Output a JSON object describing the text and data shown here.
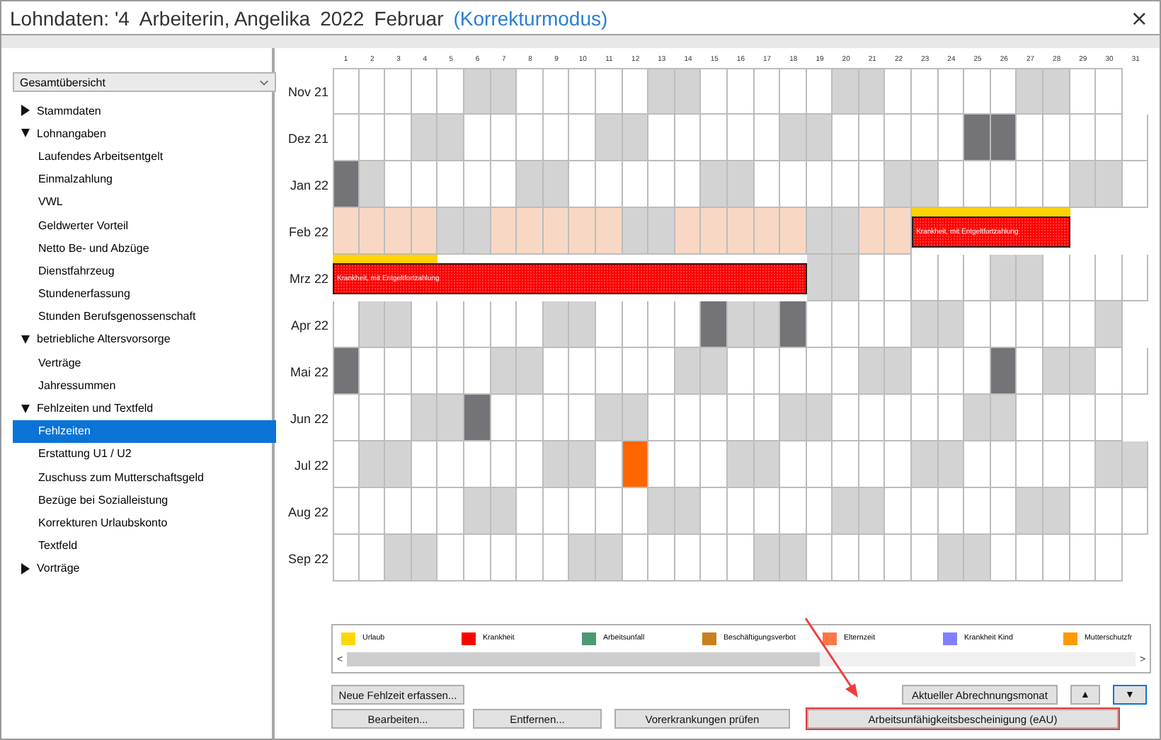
{
  "window": {
    "title_parts": [
      "Lohndaten: '4",
      "Arbeiterin, Angelika",
      "2022",
      "Februar"
    ],
    "mode": "(Korrekturmodus)",
    "close_glyph": "×"
  },
  "sidebar": {
    "dropdown": {
      "value": "Gesamtübersicht"
    },
    "tree": [
      {
        "label": "Stammdaten",
        "expanded": false
      },
      {
        "label": "Lohnangaben",
        "expanded": true,
        "children": [
          {
            "label": "Laufendes Arbeitsentgelt",
            "selected": false
          },
          {
            "label": "Einmalzahlung",
            "selected": false
          },
          {
            "label": "VWL",
            "selected": false
          },
          {
            "label": "Geldwerter Vorteil",
            "selected": false
          },
          {
            "label": "Netto Be- und Abzüge",
            "selected": false
          },
          {
            "label": "Dienstfahrzeug",
            "selected": false
          },
          {
            "label": "Stundenerfassung",
            "selected": false
          },
          {
            "label": "Stunden Berufsgenossenschaft",
            "selected": false
          }
        ]
      },
      {
        "label": "betriebliche Altersvorsorge",
        "expanded": true,
        "children": [
          {
            "label": "Verträge",
            "selected": false
          },
          {
            "label": "Jahressummen",
            "selected": false
          }
        ]
      },
      {
        "label": "Fehlzeiten und Textfeld",
        "expanded": true,
        "children": [
          {
            "label": "Fehlzeiten",
            "selected": true
          },
          {
            "label": "Erstattung U1 / U2",
            "selected": false
          },
          {
            "label": "Zuschuss zum Mutterschaftsgeld",
            "selected": false
          },
          {
            "label": "Bezüge bei Sozialleistung",
            "selected": false
          },
          {
            "label": "Korrekturen Urlaubskonto",
            "selected": false
          },
          {
            "label": "Textfeld",
            "selected": false
          }
        ]
      },
      {
        "label": "Vorträge",
        "expanded": false
      }
    ]
  },
  "calendar": {
    "day_numbers": [
      "1",
      "2",
      "3",
      "4",
      "5",
      "6",
      "7",
      "8",
      "9",
      "10",
      "11",
      "12",
      "13",
      "14",
      "15",
      "16",
      "17",
      "18",
      "19",
      "20",
      "21",
      "22",
      "23",
      "24",
      "25",
      "26",
      "27",
      "28",
      "29",
      "30",
      "31"
    ],
    "months": [
      {
        "label": "Nov 21",
        "days": [
          {
            "kind": "work"
          },
          {
            "kind": "work"
          },
          {
            "kind": "work"
          },
          {
            "kind": "work"
          },
          {
            "kind": "work"
          },
          {
            "kind": "off"
          },
          {
            "kind": "off"
          },
          {
            "kind": "work"
          },
          {
            "kind": "work"
          },
          {
            "kind": "work"
          },
          {
            "kind": "work"
          },
          {
            "kind": "work"
          },
          {
            "kind": "off"
          },
          {
            "kind": "off"
          },
          {
            "kind": "work"
          },
          {
            "kind": "work"
          },
          {
            "kind": "work"
          },
          {
            "kind": "work"
          },
          {
            "kind": "work"
          },
          {
            "kind": "off"
          },
          {
            "kind": "off"
          },
          {
            "kind": "work"
          },
          {
            "kind": "work"
          },
          {
            "kind": "work"
          },
          {
            "kind": "work"
          },
          {
            "kind": "work"
          },
          {
            "kind": "off"
          },
          {
            "kind": "off"
          },
          {
            "kind": "work"
          },
          {
            "kind": "work"
          }
        ]
      },
      {
        "label": "Dez 21",
        "days": [
          {
            "kind": "work"
          },
          {
            "kind": "work"
          },
          {
            "kind": "work"
          },
          {
            "kind": "off"
          },
          {
            "kind": "off"
          },
          {
            "kind": "work"
          },
          {
            "kind": "work"
          },
          {
            "kind": "work"
          },
          {
            "kind": "work"
          },
          {
            "kind": "work"
          },
          {
            "kind": "off"
          },
          {
            "kind": "off"
          },
          {
            "kind": "work"
          },
          {
            "kind": "work"
          },
          {
            "kind": "work"
          },
          {
            "kind": "work"
          },
          {
            "kind": "work"
          },
          {
            "kind": "off"
          },
          {
            "kind": "off"
          },
          {
            "kind": "work"
          },
          {
            "kind": "work"
          },
          {
            "kind": "work"
          },
          {
            "kind": "work"
          },
          {
            "kind": "work"
          },
          {
            "kind": "holiday"
          },
          {
            "kind": "holiday"
          },
          {
            "kind": "work"
          },
          {
            "kind": "work"
          },
          {
            "kind": "work"
          },
          {
            "kind": "work"
          },
          {
            "kind": "work"
          }
        ]
      },
      {
        "label": "Jan 22",
        "days": [
          {
            "kind": "holiday"
          },
          {
            "kind": "off"
          },
          {
            "kind": "work"
          },
          {
            "kind": "work"
          },
          {
            "kind": "work"
          },
          {
            "kind": "work"
          },
          {
            "kind": "work"
          },
          {
            "kind": "off"
          },
          {
            "kind": "off"
          },
          {
            "kind": "work"
          },
          {
            "kind": "work"
          },
          {
            "kind": "work"
          },
          {
            "kind": "work"
          },
          {
            "kind": "work"
          },
          {
            "kind": "off"
          },
          {
            "kind": "off"
          },
          {
            "kind": "work"
          },
          {
            "kind": "work"
          },
          {
            "kind": "work"
          },
          {
            "kind": "work"
          },
          {
            "kind": "work"
          },
          {
            "kind": "off"
          },
          {
            "kind": "off"
          },
          {
            "kind": "work"
          },
          {
            "kind": "work"
          },
          {
            "kind": "work"
          },
          {
            "kind": "work"
          },
          {
            "kind": "work"
          },
          {
            "kind": "off"
          },
          {
            "kind": "off"
          },
          {
            "kind": "work"
          }
        ]
      },
      {
        "label": "Feb 22",
        "absence_label": "Krankheit, mit Entgeltfortzahlung",
        "days": [
          {
            "kind": "month"
          },
          {
            "kind": "month"
          },
          {
            "kind": "month"
          },
          {
            "kind": "month"
          },
          {
            "kind": "off"
          },
          {
            "kind": "off"
          },
          {
            "kind": "month"
          },
          {
            "kind": "month"
          },
          {
            "kind": "month"
          },
          {
            "kind": "month"
          },
          {
            "kind": "month"
          },
          {
            "kind": "off"
          },
          {
            "kind": "off"
          },
          {
            "kind": "month"
          },
          {
            "kind": "month"
          },
          {
            "kind": "month"
          },
          {
            "kind": "month"
          },
          {
            "kind": "month"
          },
          {
            "kind": "off"
          },
          {
            "kind": "off"
          },
          {
            "kind": "month"
          },
          {
            "kind": "month"
          },
          {
            "kind": "sickvac"
          },
          {
            "kind": "sickvac"
          },
          {
            "kind": "sickvac"
          },
          {
            "kind": "sickvac"
          },
          {
            "kind": "sickvac"
          },
          {
            "kind": "sickvac"
          }
        ]
      },
      {
        "label": "Mrz 22",
        "absence_label": "Krankheit, mit Entgeltfortzahlung",
        "days": [
          {
            "kind": "sickvac"
          },
          {
            "kind": "sickvac"
          },
          {
            "kind": "sickvac"
          },
          {
            "kind": "sickvac"
          },
          {
            "kind": "sick"
          },
          {
            "kind": "sick"
          },
          {
            "kind": "sick"
          },
          {
            "kind": "sick"
          },
          {
            "kind": "sick"
          },
          {
            "kind": "sick"
          },
          {
            "kind": "sick"
          },
          {
            "kind": "sick"
          },
          {
            "kind": "sick"
          },
          {
            "kind": "sick"
          },
          {
            "kind": "sick"
          },
          {
            "kind": "sick"
          },
          {
            "kind": "sick"
          },
          {
            "kind": "sick"
          },
          {
            "kind": "off"
          },
          {
            "kind": "off"
          },
          {
            "kind": "work"
          },
          {
            "kind": "work"
          },
          {
            "kind": "work"
          },
          {
            "kind": "work"
          },
          {
            "kind": "work"
          },
          {
            "kind": "off"
          },
          {
            "kind": "off"
          },
          {
            "kind": "work"
          },
          {
            "kind": "work"
          },
          {
            "kind": "work"
          },
          {
            "kind": "work"
          }
        ]
      },
      {
        "label": "Apr 22",
        "days": [
          {
            "kind": "work"
          },
          {
            "kind": "off"
          },
          {
            "kind": "off"
          },
          {
            "kind": "work"
          },
          {
            "kind": "work"
          },
          {
            "kind": "work"
          },
          {
            "kind": "work"
          },
          {
            "kind": "work"
          },
          {
            "kind": "off"
          },
          {
            "kind": "off"
          },
          {
            "kind": "work"
          },
          {
            "kind": "work"
          },
          {
            "kind": "work"
          },
          {
            "kind": "work"
          },
          {
            "kind": "holiday"
          },
          {
            "kind": "off"
          },
          {
            "kind": "off"
          },
          {
            "kind": "holiday"
          },
          {
            "kind": "work"
          },
          {
            "kind": "work"
          },
          {
            "kind": "work"
          },
          {
            "kind": "work"
          },
          {
            "kind": "off"
          },
          {
            "kind": "off"
          },
          {
            "kind": "work"
          },
          {
            "kind": "work"
          },
          {
            "kind": "work"
          },
          {
            "kind": "work"
          },
          {
            "kind": "work"
          },
          {
            "kind": "off"
          }
        ]
      },
      {
        "label": "Mai 22",
        "days": [
          {
            "kind": "holiday"
          },
          {
            "kind": "work"
          },
          {
            "kind": "work"
          },
          {
            "kind": "work"
          },
          {
            "kind": "work"
          },
          {
            "kind": "work"
          },
          {
            "kind": "off"
          },
          {
            "kind": "off"
          },
          {
            "kind": "work"
          },
          {
            "kind": "work"
          },
          {
            "kind": "work"
          },
          {
            "kind": "work"
          },
          {
            "kind": "work"
          },
          {
            "kind": "off"
          },
          {
            "kind": "off"
          },
          {
            "kind": "work"
          },
          {
            "kind": "work"
          },
          {
            "kind": "work"
          },
          {
            "kind": "work"
          },
          {
            "kind": "work"
          },
          {
            "kind": "off"
          },
          {
            "kind": "off"
          },
          {
            "kind": "work"
          },
          {
            "kind": "work"
          },
          {
            "kind": "work"
          },
          {
            "kind": "holiday"
          },
          {
            "kind": "work"
          },
          {
            "kind": "off"
          },
          {
            "kind": "off"
          },
          {
            "kind": "work"
          },
          {
            "kind": "work"
          }
        ]
      },
      {
        "label": "Jun 22",
        "days": [
          {
            "kind": "work"
          },
          {
            "kind": "work"
          },
          {
            "kind": "work"
          },
          {
            "kind": "off"
          },
          {
            "kind": "off"
          },
          {
            "kind": "holiday"
          },
          {
            "kind": "work"
          },
          {
            "kind": "work"
          },
          {
            "kind": "work"
          },
          {
            "kind": "work"
          },
          {
            "kind": "off"
          },
          {
            "kind": "off"
          },
          {
            "kind": "work"
          },
          {
            "kind": "work"
          },
          {
            "kind": "work"
          },
          {
            "kind": "work"
          },
          {
            "kind": "work"
          },
          {
            "kind": "off"
          },
          {
            "kind": "off"
          },
          {
            "kind": "work"
          },
          {
            "kind": "work"
          },
          {
            "kind": "work"
          },
          {
            "kind": "work"
          },
          {
            "kind": "work"
          },
          {
            "kind": "off"
          },
          {
            "kind": "off"
          },
          {
            "kind": "work"
          },
          {
            "kind": "work"
          },
          {
            "kind": "work"
          },
          {
            "kind": "work"
          }
        ]
      },
      {
        "label": "Jul 22",
        "days": [
          {
            "kind": "work"
          },
          {
            "kind": "off"
          },
          {
            "kind": "off"
          },
          {
            "kind": "work"
          },
          {
            "kind": "work"
          },
          {
            "kind": "work"
          },
          {
            "kind": "work"
          },
          {
            "kind": "work"
          },
          {
            "kind": "off"
          },
          {
            "kind": "off"
          },
          {
            "kind": "work"
          },
          {
            "kind": "absence"
          },
          {
            "kind": "work"
          },
          {
            "kind": "work"
          },
          {
            "kind": "work"
          },
          {
            "kind": "off"
          },
          {
            "kind": "off"
          },
          {
            "kind": "work"
          },
          {
            "kind": "work"
          },
          {
            "kind": "work"
          },
          {
            "kind": "work"
          },
          {
            "kind": "work"
          },
          {
            "kind": "off"
          },
          {
            "kind": "off"
          },
          {
            "kind": "work"
          },
          {
            "kind": "work"
          },
          {
            "kind": "work"
          },
          {
            "kind": "work"
          },
          {
            "kind": "work"
          },
          {
            "kind": "off"
          },
          {
            "kind": "off"
          }
        ]
      },
      {
        "label": "Aug 22",
        "days": [
          {
            "kind": "work"
          },
          {
            "kind": "work"
          },
          {
            "kind": "work"
          },
          {
            "kind": "work"
          },
          {
            "kind": "work"
          },
          {
            "kind": "off"
          },
          {
            "kind": "off"
          },
          {
            "kind": "work"
          },
          {
            "kind": "work"
          },
          {
            "kind": "work"
          },
          {
            "kind": "work"
          },
          {
            "kind": "work"
          },
          {
            "kind": "off"
          },
          {
            "kind": "off"
          },
          {
            "kind": "work"
          },
          {
            "kind": "work"
          },
          {
            "kind": "work"
          },
          {
            "kind": "work"
          },
          {
            "kind": "work"
          },
          {
            "kind": "off"
          },
          {
            "kind": "off"
          },
          {
            "kind": "work"
          },
          {
            "kind": "work"
          },
          {
            "kind": "work"
          },
          {
            "kind": "work"
          },
          {
            "kind": "work"
          },
          {
            "kind": "off"
          },
          {
            "kind": "off"
          },
          {
            "kind": "work"
          },
          {
            "kind": "work"
          },
          {
            "kind": "work"
          }
        ]
      },
      {
        "label": "Sep 22",
        "days": [
          {
            "kind": "work"
          },
          {
            "kind": "work"
          },
          {
            "kind": "off"
          },
          {
            "kind": "off"
          },
          {
            "kind": "work"
          },
          {
            "kind": "work"
          },
          {
            "kind": "work"
          },
          {
            "kind": "work"
          },
          {
            "kind": "work"
          },
          {
            "kind": "off"
          },
          {
            "kind": "off"
          },
          {
            "kind": "work"
          },
          {
            "kind": "work"
          },
          {
            "kind": "work"
          },
          {
            "kind": "work"
          },
          {
            "kind": "work"
          },
          {
            "kind": "off"
          },
          {
            "kind": "off"
          },
          {
            "kind": "work"
          },
          {
            "kind": "work"
          },
          {
            "kind": "work"
          },
          {
            "kind": "work"
          },
          {
            "kind": "work"
          },
          {
            "kind": "off"
          },
          {
            "kind": "off"
          },
          {
            "kind": "work"
          },
          {
            "kind": "work"
          },
          {
            "kind": "work"
          },
          {
            "kind": "work"
          },
          {
            "kind": "work"
          }
        ]
      }
    ]
  },
  "legend": {
    "items": [
      {
        "label": "Urlaub",
        "color": "#ffd700"
      },
      {
        "label": "Krankheit",
        "color": "#ff0000"
      },
      {
        "label": "Arbeitsunfall",
        "color": "#4a9a72"
      },
      {
        "label": "Beschäftigungsverbot",
        "color": "#c8801e"
      },
      {
        "label": "Elternzeit",
        "color": "#ff7744"
      },
      {
        "label": "Krankheit Kind",
        "color": "#8080ff"
      },
      {
        "label": "Mutterschutzfr",
        "color": "#ff9900"
      }
    ],
    "scroll_left": "<",
    "scroll_right": ">"
  },
  "buttons_top_left": [
    "Neue Fehlzeit erfassen..."
  ],
  "buttons_top_right": [
    {
      "label": "Aktueller Abrechnungsmonat",
      "focused": false
    },
    {
      "label": "▲",
      "focused": false
    },
    {
      "label": "▼",
      "focused": true
    }
  ],
  "buttons_bottom": [
    {
      "label": "Bearbeiten...",
      "highlighted": false
    },
    {
      "label": "Entfernen...",
      "highlighted": false
    },
    {
      "label": "Vorerkrankungen prüfen",
      "highlighted": false
    },
    {
      "label": "Arbeitsunfähigkeitsbescheinigung (eAU)",
      "highlighted": true
    }
  ]
}
